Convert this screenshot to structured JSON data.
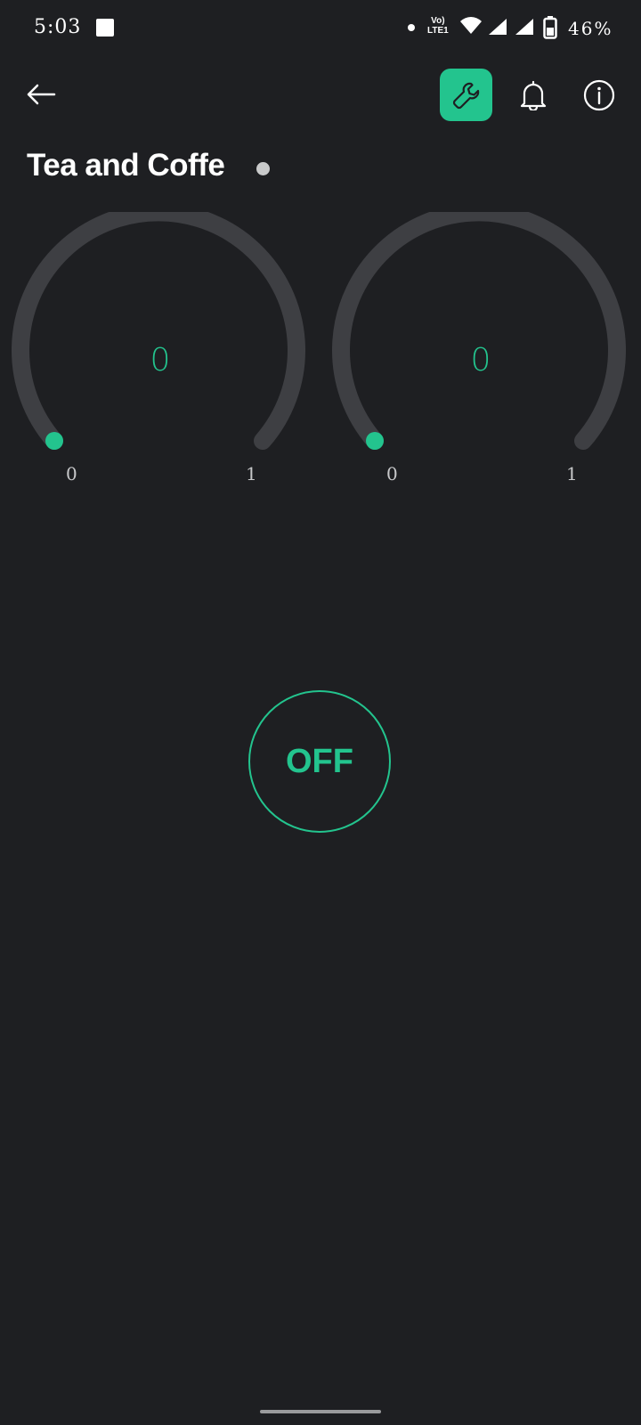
{
  "status_bar": {
    "time": "5:03",
    "network_label_top": "Vo)",
    "network_label_bottom": "LTE1",
    "battery": "46%"
  },
  "header": {
    "title": "Tea and Coffe",
    "icons": [
      "back-arrow-icon",
      "wrench-icon",
      "bell-icon",
      "info-icon"
    ]
  },
  "gauges": [
    {
      "value": "0",
      "min": "0",
      "max": "1"
    },
    {
      "value": "0",
      "min": "0",
      "max": "1"
    }
  ],
  "power_button": {
    "label": "OFF"
  },
  "colors": {
    "accent": "#23c48e",
    "background": "#1e1f22",
    "track": "#3e3f43",
    "indicator": "#c9cacb"
  }
}
